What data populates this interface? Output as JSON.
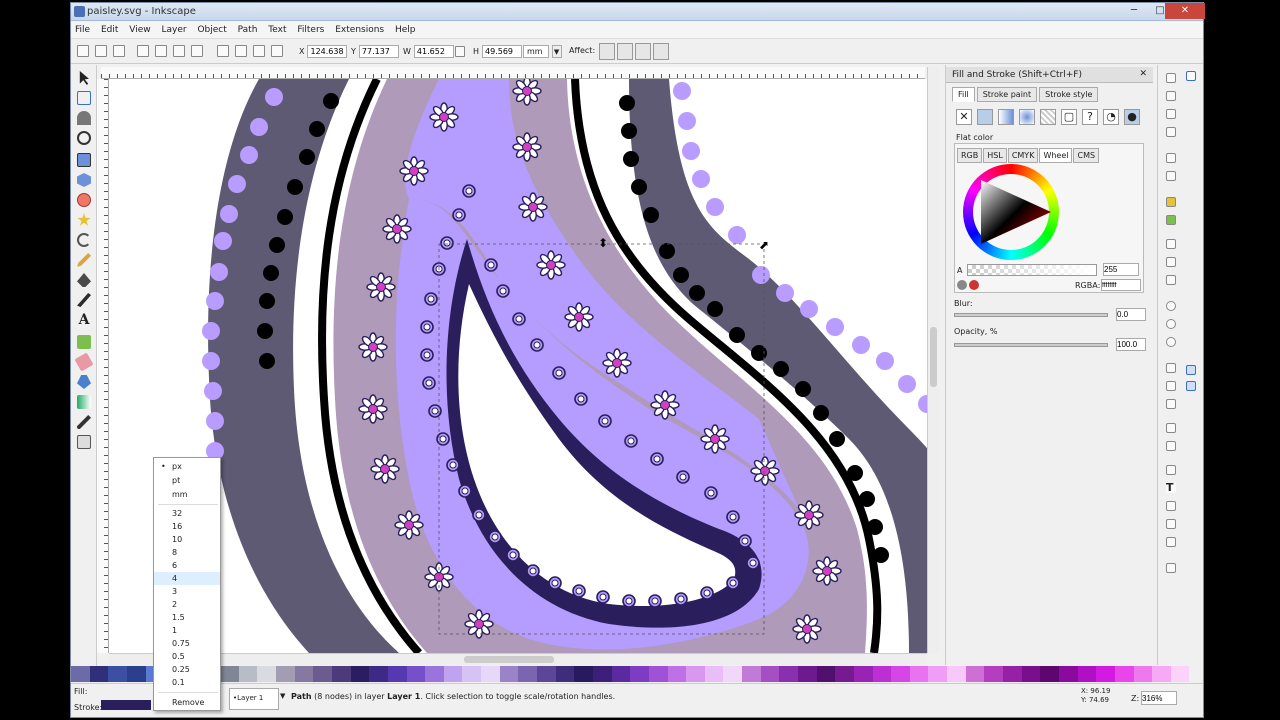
{
  "window": {
    "title": "paisley.svg - Inkscape",
    "minimize": "─",
    "maximize": "□",
    "close": "✕"
  },
  "menu": [
    "File",
    "Edit",
    "View",
    "Layer",
    "Object",
    "Path",
    "Text",
    "Filters",
    "Extensions",
    "Help"
  ],
  "toolbar": {
    "x_label": "X",
    "x_value": "124.638",
    "y_label": "Y",
    "y_value": "77.137",
    "w_label": "W",
    "w_value": "41.652",
    "h_label": "H",
    "h_value": "49.569",
    "unit": "mm",
    "affect_label": "Affect:"
  },
  "dock": {
    "title": "Fill and Stroke (Shift+Ctrl+F)",
    "tabs": [
      "Fill",
      "Stroke paint",
      "Stroke style"
    ],
    "active_tab": "Fill",
    "paint_kind": "Flat color",
    "color_modes": [
      "RGB",
      "HSL",
      "CMYK",
      "Wheel",
      "CMS"
    ],
    "active_mode": "Wheel",
    "alpha_label": "A",
    "alpha_value": "255",
    "rgba_label": "RGBA:",
    "rgba_value": "ffffffff",
    "blur_label": "Blur:",
    "blur_value": "0.0",
    "opacity_label": "Opacity, %",
    "opacity_value": "100.0"
  },
  "stroke_width_popup": {
    "units": [
      "px",
      "pt",
      "mm"
    ],
    "selected_unit": "px",
    "widths": [
      "32",
      "16",
      "10",
      "8",
      "6",
      "4",
      "3",
      "2",
      "1.5",
      "1",
      "0.75",
      "0.5",
      "0.25",
      "0.1"
    ],
    "hovered_width": "4",
    "remove_label": "Remove"
  },
  "status": {
    "fill_label": "Fill:",
    "stroke_label": "Stroke:",
    "layer": "•Layer 1",
    "message_bold": "Path",
    "message": " (8 nodes) in layer ",
    "message_layer": "Layer 1",
    "message_tail": ". Click selection to toggle scale/rotation handles.",
    "x_label": "X:",
    "x_value": "96.19",
    "y_label": "Y:",
    "y_value": "74.69",
    "z_label": "Z:",
    "zoom": "316%"
  },
  "colors": {
    "dark_band": "#5e5a73",
    "light_purple": "#b59cff",
    "mauve": "#b09aba",
    "navy": "#2a1f5c",
    "flower_center": "#d040c0",
    "dot_border": "#b99cff"
  },
  "palette_colors": [
    "#6d6aa8",
    "#2f2f7a",
    "#3d4fa3",
    "#2b3f8e",
    "#5a7bd1",
    "#8fa6e6",
    "#b0c2ee",
    "#9aa7bd",
    "#7f8797",
    "#b8bcc6",
    "#d9dbe0",
    "#a39db3",
    "#8579a1",
    "#6b5c8f",
    "#4b3b7a",
    "#2a1d62",
    "#3d2a87",
    "#5639b0",
    "#7650c9",
    "#9a74dc",
    "#c0a3ee",
    "#d6c2f5",
    "#e6d8fa",
    "#9c82c8",
    "#7b64b0",
    "#5c4697",
    "#3e2d7a",
    "#281a5e",
    "#3d1f7a",
    "#5a2a9e",
    "#7d3cc2",
    "#a052d6",
    "#c070e6",
    "#d898f0",
    "#e9bdf6",
    "#f1d8fa",
    "#c27ad8",
    "#a450c2",
    "#8a2fad",
    "#6e1a8f",
    "#51106e",
    "#751a8f",
    "#9a22b5",
    "#bc2fd3",
    "#d645e6",
    "#e872f0",
    "#f09ef5",
    "#f7c8fa",
    "#cf6fd6",
    "#b33fbe",
    "#9621a6",
    "#790f8a",
    "#5e0670",
    "#8a0a9e",
    "#b010c4",
    "#d21ae0",
    "#e846ea",
    "#f078ef",
    "#f7a9f5",
    "#fbd3f9"
  ]
}
